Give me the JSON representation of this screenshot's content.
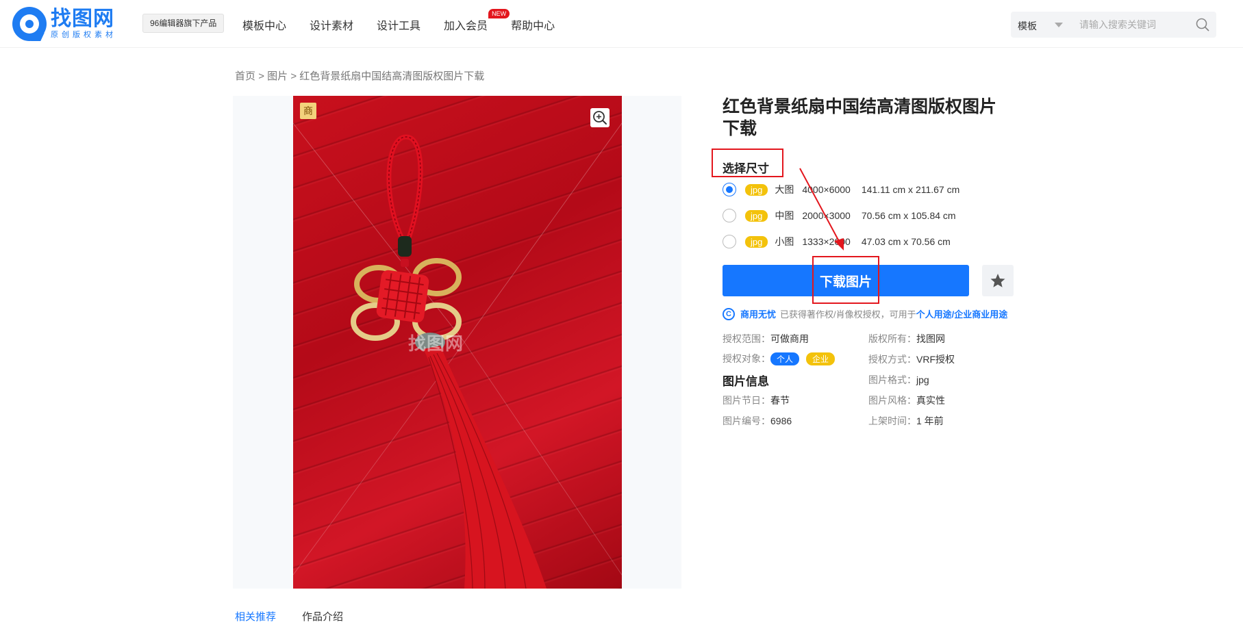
{
  "header": {
    "logo_main": "找图网",
    "logo_sub": "原创版权素材",
    "product_tag": "96编辑器旗下产品",
    "nav": [
      {
        "label": "模板中心"
      },
      {
        "label": "设计素材"
      },
      {
        "label": "设计工具"
      },
      {
        "label": "加入会员",
        "badge": "NEW"
      },
      {
        "label": "帮助中心"
      }
    ],
    "search": {
      "category": "模板",
      "placeholder": "请输入搜索关键词",
      "icon": "search-icon"
    }
  },
  "breadcrumb": {
    "home": "首页",
    "sep": ">",
    "section": "图片",
    "current": "红色背景纸扇中国结高清图版权图片下载"
  },
  "preview": {
    "badge": "商",
    "zoom_icon": "zoom-in-icon",
    "watermark": "找图网"
  },
  "detail": {
    "title": "红色背景纸扇中国结高清图版权图片下载",
    "size_label": "选择尺寸",
    "options": [
      {
        "format": "jpg",
        "name": "大图",
        "pixels": "4000×6000",
        "cm": "141.11 cm x 211.67 cm",
        "selected": true
      },
      {
        "format": "jpg",
        "name": "中图",
        "pixels": "2000×3000",
        "cm": "70.56 cm x 105.84 cm",
        "selected": false
      },
      {
        "format": "jpg",
        "name": "小图",
        "pixels": "1333×2000",
        "cm": "47.03 cm x 70.56 cm",
        "selected": false
      }
    ],
    "download_label": "下载图片",
    "fav_icon": "star-icon",
    "license": {
      "icon_text": "C",
      "strong": "商用无忧",
      "text": "已获得著作权/肖像权授权，可用于",
      "link": "个人用途/企业商业用途"
    },
    "meta": {
      "scope_label": "授权范围：",
      "scope_value": "可做商用",
      "owner_label": "版权所有：",
      "owner_value": "找图网",
      "target_label": "授权对象：",
      "target_personal": "个人",
      "target_company": "企业",
      "method_label": "授权方式：",
      "method_value": "VRF授权"
    },
    "info_title": "图片信息",
    "info": {
      "format_label": "图片格式：",
      "format_value": "jpg",
      "festival_label": "图片节日：",
      "festival_value": "春节",
      "style_label": "图片风格：",
      "style_value": "真实性",
      "id_label": "图片编号：",
      "id_value": "6986",
      "time_label": "上架时间：",
      "time_value": "1 年前"
    }
  },
  "tabs": [
    {
      "label": "相关推荐",
      "active": true
    },
    {
      "label": "作品介绍",
      "active": false
    }
  ],
  "colors": {
    "brand": "#1e7cf2",
    "primary": "#1677ff",
    "accent_yellow": "#f3c20b",
    "annotation_red": "#e3161d"
  }
}
